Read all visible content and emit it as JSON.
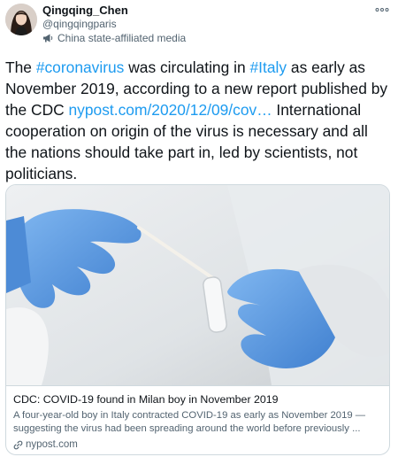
{
  "author": {
    "display_name": "Qingqing_Chen",
    "handle": "@qingqingparis",
    "affiliation_label": "China state-affiliated media",
    "affiliation_icon": "megaphone-icon",
    "more_icon": "more-dots-icon"
  },
  "tweet": {
    "segments": [
      {
        "text": "The ",
        "kind": "text"
      },
      {
        "text": "#coronavirus",
        "kind": "hashtag"
      },
      {
        "text": " was circulating in ",
        "kind": "text"
      },
      {
        "text": "#Italy",
        "kind": "hashtag"
      },
      {
        "text": " as early as November 2019, according to a new report published by the CDC ",
        "kind": "text"
      },
      {
        "text": "nypost.com/2020/12/09/cov…",
        "kind": "url"
      },
      {
        "text": " International cooperation on origin of the virus is necessary and all the nations should take part in, led by scientists, not politicians.",
        "kind": "text"
      }
    ]
  },
  "card": {
    "title": "CDC: COVID-19 found in Milan boy in November 2019",
    "description": "A four-year-old boy in Italy contracted COVID-19 as early as November 2019 — suggesting the virus had been spreading around the world before previously ...",
    "domain": "nypost.com",
    "domain_icon": "link-icon"
  },
  "colors": {
    "link": "#1d9bf0",
    "text": "#0f1419",
    "secondary": "#536471",
    "border": "#cfd9de",
    "glove": "#5d9be0"
  }
}
